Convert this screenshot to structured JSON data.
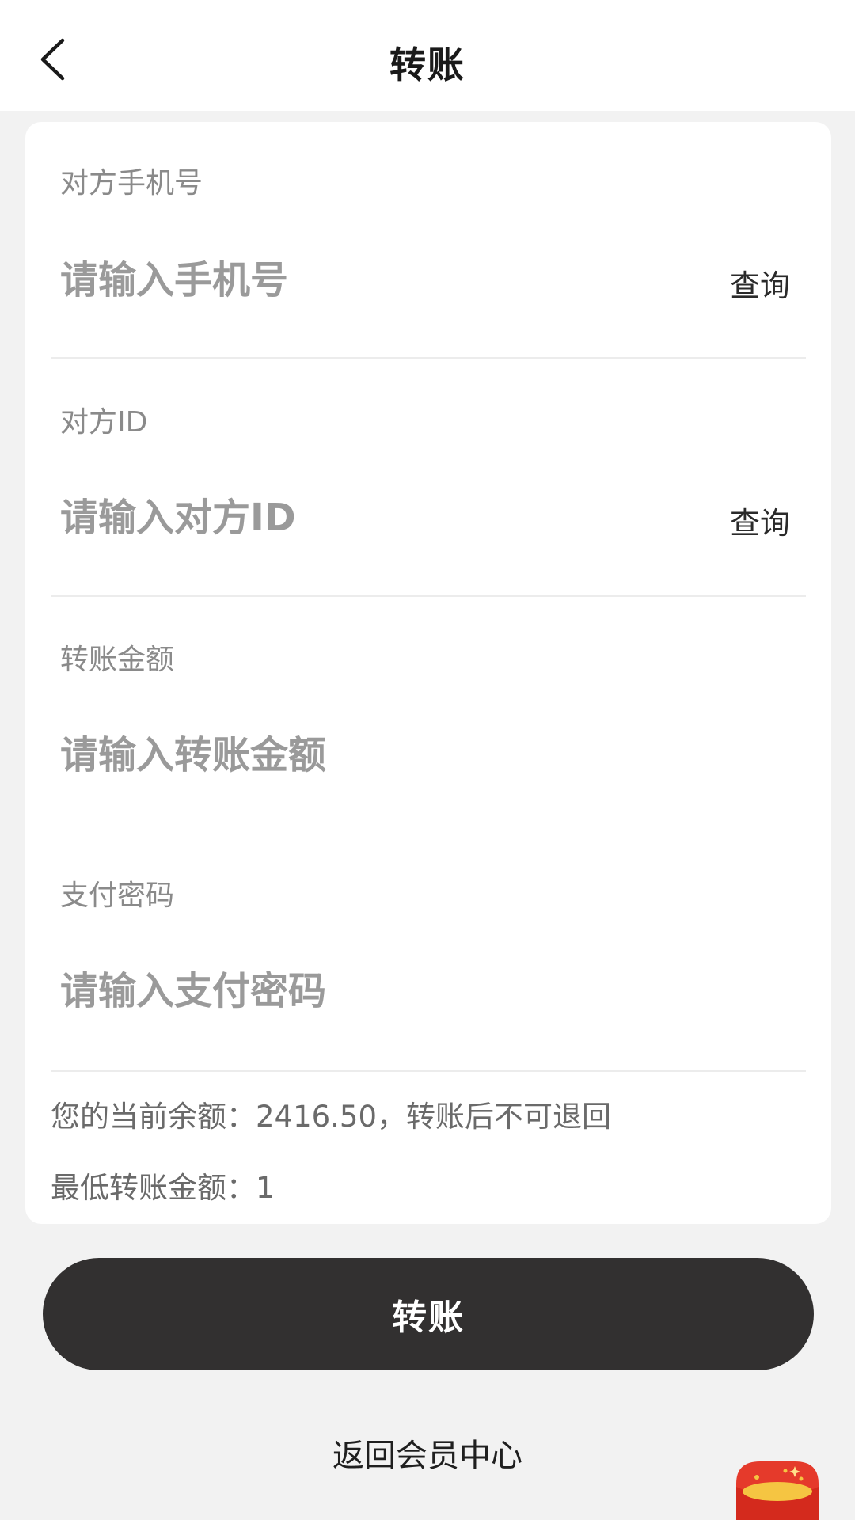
{
  "header": {
    "title": "转账"
  },
  "form": {
    "phone": {
      "label": "对方手机号",
      "placeholder": "请输入手机号",
      "query_label": "查询"
    },
    "user_id": {
      "label": "对方ID",
      "placeholder": "请输入对方ID",
      "query_label": "查询"
    },
    "amount": {
      "label": "转账金额",
      "placeholder": "请输入转账金额"
    },
    "password": {
      "label": "支付密码",
      "placeholder": "请输入支付密码"
    },
    "balance_notice": "您的当前余额：2416.50，转账后不可退回",
    "min_amount_notice": "最低转账金额：1"
  },
  "actions": {
    "submit_label": "转账",
    "back_link_label": "返回会员中心"
  },
  "colors": {
    "button_bg": "#323030",
    "envelope_red": "#e53a2b",
    "envelope_gold": "#f5c542"
  },
  "icons": {
    "back": "chevron-left-icon",
    "floating": "red-envelope-icon"
  }
}
